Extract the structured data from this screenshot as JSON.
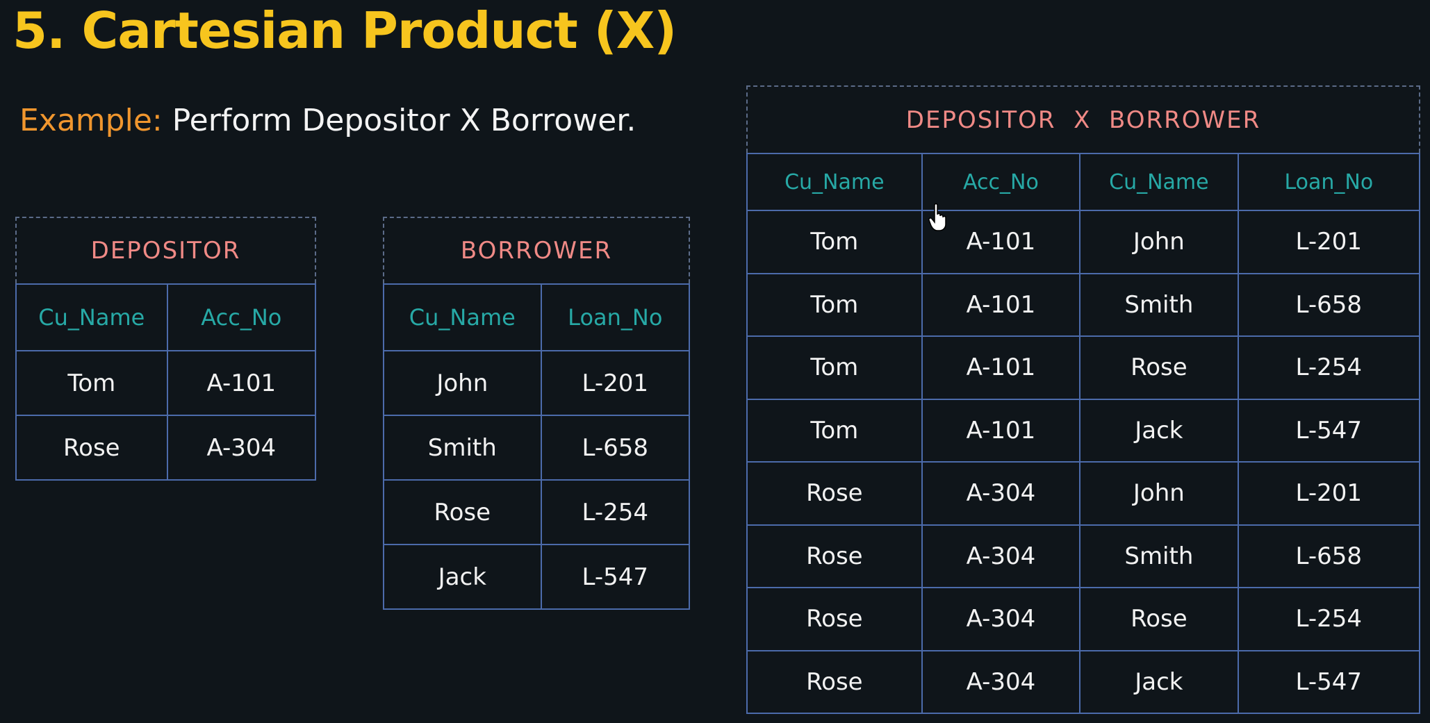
{
  "title": "5. Cartesian Product (X)",
  "example": {
    "label": "Example:",
    "text": "Perform Depositor X Borrower."
  },
  "depositor": {
    "caption": "DEPOSITOR",
    "headers": [
      "Cu_Name",
      "Acc_No"
    ],
    "rows": [
      [
        "Tom",
        "A-101"
      ],
      [
        "Rose",
        "A-304"
      ]
    ]
  },
  "borrower": {
    "caption": "BORROWER",
    "headers": [
      "Cu_Name",
      "Loan_No"
    ],
    "rows": [
      [
        "John",
        "L-201"
      ],
      [
        "Smith",
        "L-658"
      ],
      [
        "Rose",
        "L-254"
      ],
      [
        "Jack",
        "L-547"
      ]
    ]
  },
  "product": {
    "caption": "DEPOSITOR  X  BORROWER",
    "headers": [
      "Cu_Name",
      "Acc_No",
      "Cu_Name",
      "Loan_No"
    ],
    "rows": [
      [
        "Tom",
        "A-101",
        "John",
        "L-201"
      ],
      [
        "Tom",
        "A-101",
        "Smith",
        "L-658"
      ],
      [
        "Tom",
        "A-101",
        "Rose",
        "L-254"
      ],
      [
        "Tom",
        "A-101",
        "Jack",
        "L-547"
      ],
      [
        "Rose",
        "A-304",
        "John",
        "L-201"
      ],
      [
        "Rose",
        "A-304",
        "Smith",
        "L-658"
      ],
      [
        "Rose",
        "A-304",
        "Rose",
        "L-254"
      ],
      [
        "Rose",
        "A-304",
        "Jack",
        "L-547"
      ]
    ]
  },
  "colors": {
    "title": "#f7c51e",
    "example_label": "#f0962e",
    "caption": "#f08a86",
    "header": "#27a9a6",
    "border": "#4c6bab"
  }
}
